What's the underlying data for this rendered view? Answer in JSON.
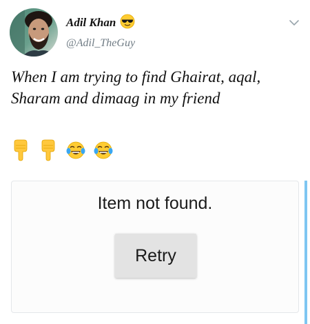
{
  "tweet": {
    "author": {
      "display_name": "Adil Khan",
      "name_emoji": "😎",
      "handle": "@Adil_TheGuy",
      "avatar": "profile-photo"
    },
    "menu_icon": "chevron-down-icon",
    "text": "When I am trying to find Ghairat, aqal, Sharam and dimaag in my friend",
    "emojis": [
      "👇",
      "👇",
      "😂",
      "😂"
    ]
  },
  "embedded_card": {
    "message": "Item not found.",
    "retry_label": "Retry"
  },
  "colors": {
    "handle": "#6f7b84",
    "card_accent": "#7ec6f2",
    "button_bg": "#e3e3e3"
  }
}
